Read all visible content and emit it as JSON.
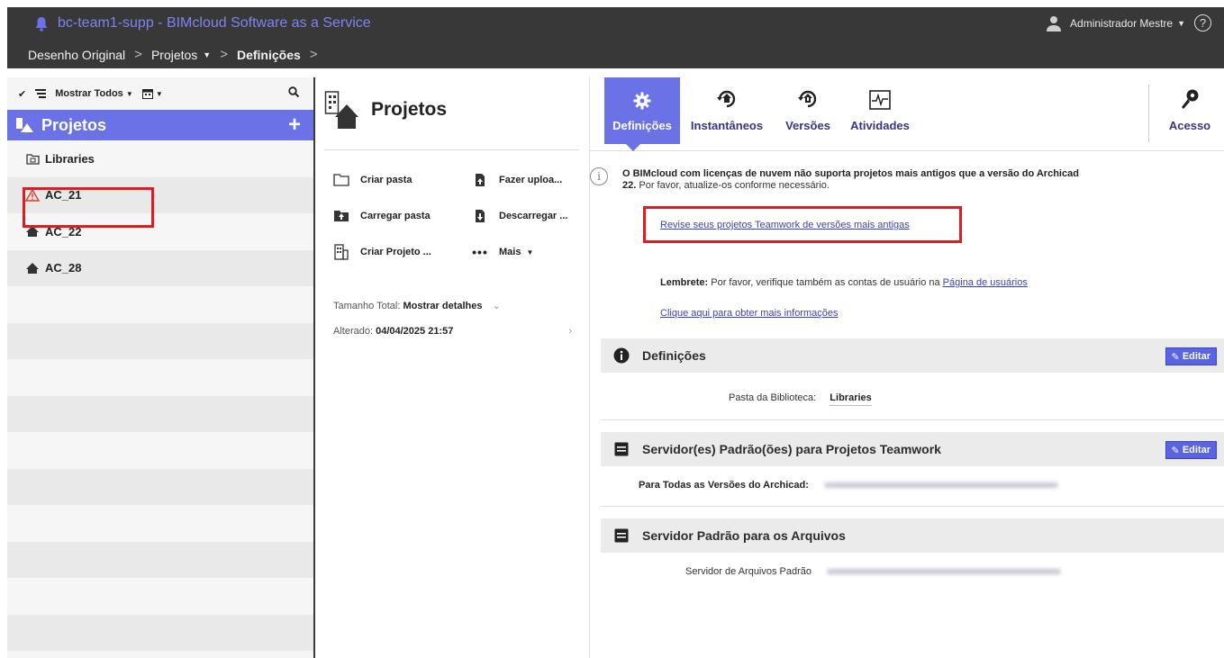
{
  "header": {
    "app_title": "bc-team1-supp - BIMcloud Software as a Service",
    "user_name": "Administrador Mestre",
    "help_label": "?",
    "breadcrumb": [
      "Desenho Original",
      "Projetos",
      "Definições"
    ]
  },
  "sidebar": {
    "filter_label": "Mostrar Todos",
    "section_title": "Projetos",
    "add_label": "+",
    "items": [
      {
        "label": "Libraries",
        "icon": "library-folder-icon"
      },
      {
        "label": "AC_21",
        "icon": "warning-icon"
      },
      {
        "label": "AC_22",
        "icon": "project-icon"
      },
      {
        "label": "AC_28",
        "icon": "project-icon"
      }
    ]
  },
  "middle": {
    "title": "Projetos",
    "actions": {
      "create_folder": "Criar pasta",
      "upload": "Fazer uploa...",
      "load_folder": "Carregar pasta",
      "download": "Descarregar ...",
      "create_project": "Criar Projeto ...",
      "more": "Mais"
    },
    "total_size_label": "Tamanho Total:",
    "total_size_value": "Mostrar detalhes",
    "modified_label": "Alterado:",
    "modified_value": "04/04/2025 21:57"
  },
  "tabs": [
    {
      "label": "Definições",
      "icon": "gear-icon",
      "active": true
    },
    {
      "label": "Instantâneos",
      "icon": "snapshot-icon",
      "active": false
    },
    {
      "label": "Versões",
      "icon": "versions-icon",
      "active": false
    },
    {
      "label": "Atividades",
      "icon": "activity-icon",
      "active": false
    },
    {
      "label": "Acesso",
      "icon": "key-icon",
      "active": false
    }
  ],
  "notice": {
    "main": "O BIMcloud com licenças de nuvem não suporta projetos mais antigos que a versão do Archicad",
    "version": "22.",
    "sub": "Por favor, atualize-os conforme necessário.",
    "review_link": "Revise seus projetos Teamwork de versões mais antigas",
    "reminder_bold": "Lembrete:",
    "reminder_text": "Por favor, verifique também as contas de usuário na",
    "reminder_link": "Página de usuários",
    "more_info_link": "Clique aqui para obter mais informações"
  },
  "settings": {
    "title": "Definições",
    "edit_label": "Editar",
    "library_folder_label": "Pasta da Biblioteca:",
    "library_folder_value": "Libraries"
  },
  "servers": {
    "title": "Servidor(es) Padrão(ões) para Projetos Teamwork",
    "edit_label": "Editar",
    "all_versions_label": "Para Todas as Versões do Archicad:"
  },
  "file_server": {
    "title": "Servidor Padrão para os Arquivos",
    "label": "Servidor de Arquivos Padrão"
  },
  "colors": {
    "accent": "#6a72e6",
    "header_bg": "#383838",
    "highlight_red": "#e11b22",
    "link": "#3b3fbd"
  }
}
